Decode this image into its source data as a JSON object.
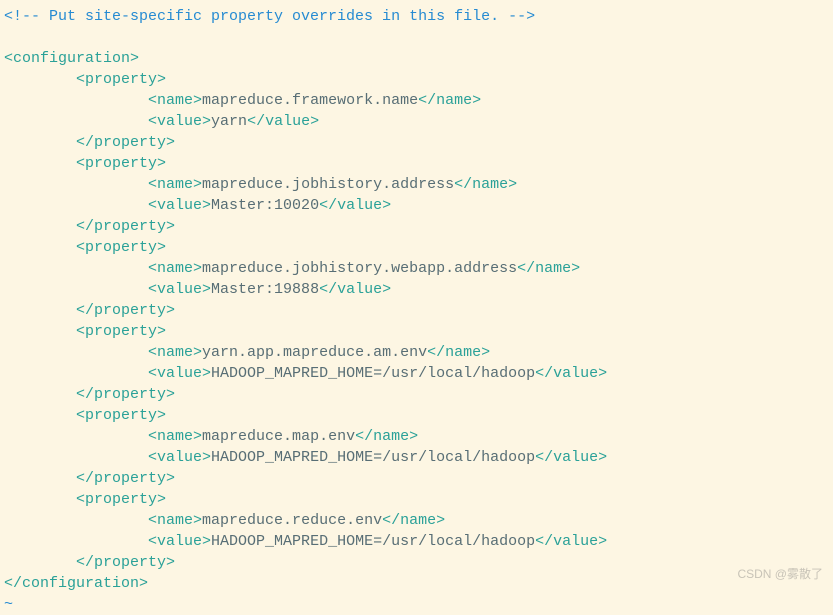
{
  "comment": "<!-- Put site-specific property overrides in this file. -->",
  "root_open": "<configuration>",
  "root_close": "</configuration>",
  "prop_open": "<property>",
  "prop_close": "</property>",
  "name_open": "<name>",
  "name_close": "</name>",
  "value_open": "<value>",
  "value_close": "</value>",
  "properties": [
    {
      "name": "mapreduce.framework.name",
      "value": "yarn"
    },
    {
      "name": "mapreduce.jobhistory.address",
      "value": "Master:10020"
    },
    {
      "name": "mapreduce.jobhistory.webapp.address",
      "value": "Master:19888"
    },
    {
      "name": "yarn.app.mapreduce.am.env",
      "value": "HADOOP_MAPRED_HOME=/usr/local/hadoop"
    },
    {
      "name": "mapreduce.map.env",
      "value": "HADOOP_MAPRED_HOME=/usr/local/hadoop"
    },
    {
      "name": "mapreduce.reduce.env",
      "value": "HADOOP_MAPRED_HOME=/usr/local/hadoop"
    }
  ],
  "tilde": "~",
  "watermark": "CSDN @雾散了"
}
